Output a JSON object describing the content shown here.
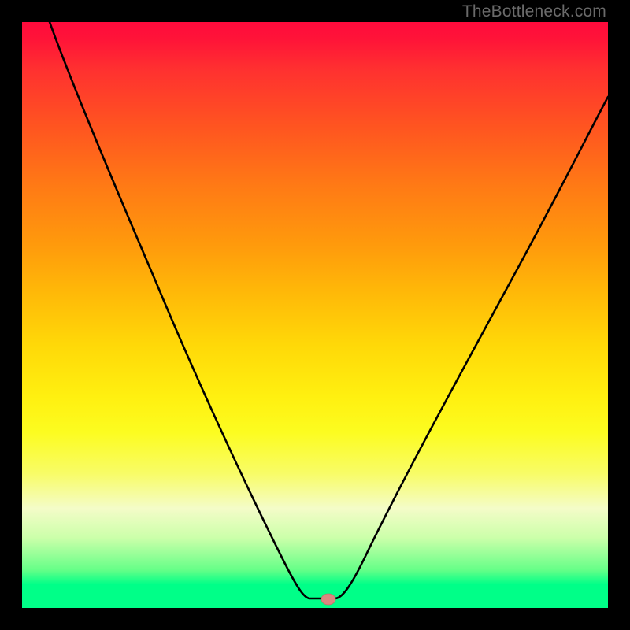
{
  "watermark": "TheBottleneck.com",
  "chart_data": {
    "type": "line",
    "title": "",
    "xlabel": "",
    "ylabel": "",
    "xlim": [
      0,
      100
    ],
    "ylim": [
      0,
      100
    ],
    "series": [
      {
        "name": "bottleneck-curve",
        "x": [
          0,
          5,
          10,
          15,
          20,
          25,
          30,
          35,
          40,
          44,
          47,
          49,
          51,
          53,
          55,
          58,
          62,
          66,
          70,
          75,
          80,
          85,
          90,
          95,
          100
        ],
        "values": [
          100,
          89,
          78,
          67,
          56,
          46,
          36,
          27,
          18,
          10,
          5,
          1.5,
          0.5,
          0.5,
          1.5,
          6,
          14,
          22,
          30,
          40,
          49,
          58,
          66,
          73,
          80
        ]
      },
      {
        "name": "marker",
        "x": [
          51.5
        ],
        "values": [
          0.8
        ]
      }
    ],
    "colors": {
      "curve": "#000000",
      "marker": "#d98880",
      "gradient_top": "#ff0a3c",
      "gradient_mid": "#ffe010",
      "gradient_bottom": "#00ff88"
    }
  }
}
